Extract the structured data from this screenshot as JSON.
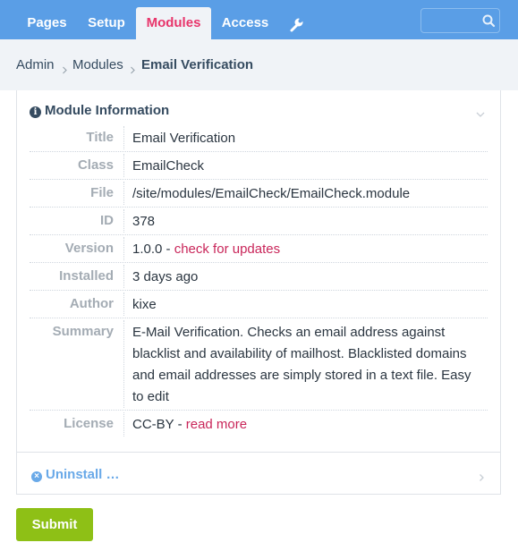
{
  "nav": {
    "tabs": [
      {
        "label": "Pages"
      },
      {
        "label": "Setup"
      },
      {
        "label": "Modules"
      },
      {
        "label": "Access"
      }
    ],
    "active_tab": "Modules",
    "tools_icon": "wrench-icon",
    "search": {
      "value": "",
      "placeholder": "",
      "icon": "search-icon"
    }
  },
  "breadcrumb": {
    "items": [
      "Admin",
      "Modules"
    ],
    "current": "Email Verification"
  },
  "module_info": {
    "heading": "Module Information",
    "heading_icon": "info-icon",
    "rows": [
      {
        "label": "Title",
        "value": "Email Verification"
      },
      {
        "label": "Class",
        "value": "EmailCheck"
      },
      {
        "label": "File",
        "value": "/site/modules/EmailCheck/EmailCheck.module"
      },
      {
        "label": "ID",
        "value": "378"
      },
      {
        "label": "Version",
        "value": "1.0.0 - ",
        "link": "check for updates"
      },
      {
        "label": "Installed",
        "value": "3 days ago"
      },
      {
        "label": "Author",
        "value": "kixe"
      },
      {
        "label": "Summary",
        "value": "E-Mail Verification. Checks an email address against blacklist and availability of mailhost. Blacklisted domains and email addresses are simply stored in a text file. Easy to edit"
      },
      {
        "label": "License",
        "value": "CC-BY - ",
        "link": "read more"
      }
    ]
  },
  "uninstall": {
    "label": "Uninstall …",
    "icon": "x-circle-icon"
  },
  "submit": {
    "label": "Submit"
  },
  "colors": {
    "nav_bg": "#5a9ee6",
    "active_tab_text": "#e8356b",
    "link": "#c9265a",
    "uninstall": "#69a9e8",
    "submit_bg": "#8ec016",
    "breadcrumb_bg": "#f0f3f7"
  }
}
